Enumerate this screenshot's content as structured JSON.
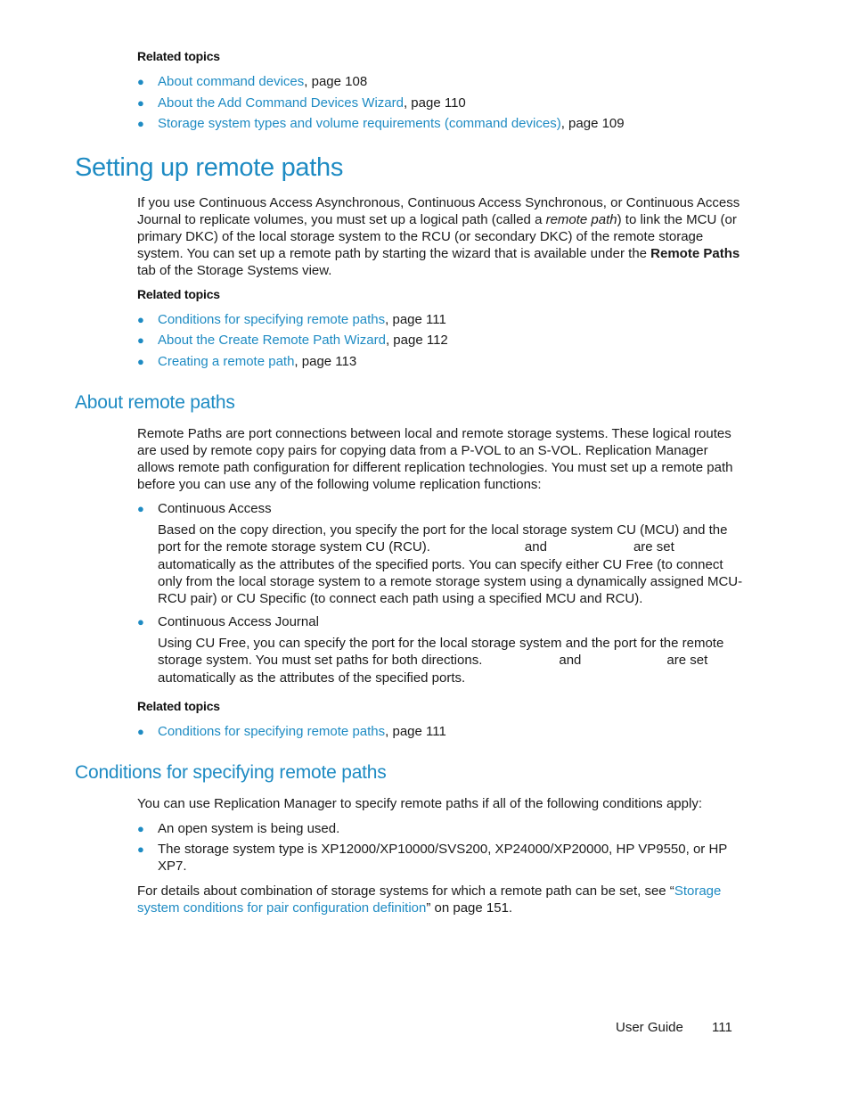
{
  "related_topics_1": {
    "heading": "Related topics",
    "items": [
      {
        "link": "About command devices",
        "suffix": ", page 108"
      },
      {
        "link": "About the Add Command Devices Wizard",
        "suffix": ", page 110"
      },
      {
        "link": "Storage system types and volume requirements (command devices)",
        "suffix": ", page 109"
      }
    ]
  },
  "section_setup": {
    "title": "Setting up remote paths",
    "para_part1": "If you use Continuous Access Asynchronous, Continuous Access Synchronous, or Continuous Access Journal to replicate volumes, you must set up a logical path (called a ",
    "para_italic": "remote path",
    "para_part2": ") to link the MCU (or primary DKC) of the local storage system to the RCU (or secondary DKC) of the remote storage system. You can set up a remote path by starting the wizard that is available under the ",
    "para_bold": "Remote Paths",
    "para_part3": " tab of the Storage Systems view.",
    "related_heading": "Related topics",
    "related": [
      {
        "link": "Conditions for specifying remote paths",
        "suffix": ", page 111"
      },
      {
        "link": "About the Create Remote Path Wizard",
        "suffix": ", page 112"
      },
      {
        "link": "Creating a remote path",
        "suffix": ", page 113"
      }
    ]
  },
  "section_about": {
    "title": "About remote paths",
    "para": "Remote Paths are port connections between local and remote storage systems. These logical routes are used by remote copy pairs for copying data from a P-VOL to an S-VOL. Replication Manager allows remote path configuration for different replication technologies. You must set up a remote path before you can use any of the following volume replication functions:",
    "items": [
      {
        "label": "Continuous Access",
        "desc_part1": "Based on the copy direction, you specify the port for the local storage system CU (MCU) and the port for the remote storage system CU (RCU).",
        "desc_and": "and",
        "desc_part2": "are set automatically as the attributes of the specified ports. You can specify either CU Free (to connect only from the local storage system to a remote storage system using a dynamically assigned MCU-RCU pair) or CU Specific (to connect each path using a specified MCU and RCU)."
      },
      {
        "label": "Continuous Access Journal",
        "desc_part1": "Using CU Free, you can specify the port for the local storage system and the port for the remote storage system. You must set paths for both directions.",
        "desc_and": "and",
        "desc_part2": "are set automatically as the attributes of the specified ports."
      }
    ],
    "related_heading": "Related topics",
    "related": [
      {
        "link": "Conditions for specifying remote paths",
        "suffix": ", page 111"
      }
    ]
  },
  "section_conditions": {
    "title": "Conditions for specifying remote paths",
    "intro": "You can use Replication Manager to specify remote paths if all of the following conditions apply:",
    "items": [
      "An open system is being used.",
      "The storage system type is XP12000/XP10000/SVS200, XP24000/XP20000, HP VP9550, or HP XP7."
    ],
    "details_prefix": "For details about combination of storage systems for which a remote path can be set, see “",
    "details_link": "Storage system conditions for pair configuration definition",
    "details_suffix": "” on page 151."
  },
  "footer": {
    "label": "User Guide",
    "page_number": "111"
  },
  "colors": {
    "accent": "#1e8bc3",
    "text": "#1a1a1a"
  }
}
